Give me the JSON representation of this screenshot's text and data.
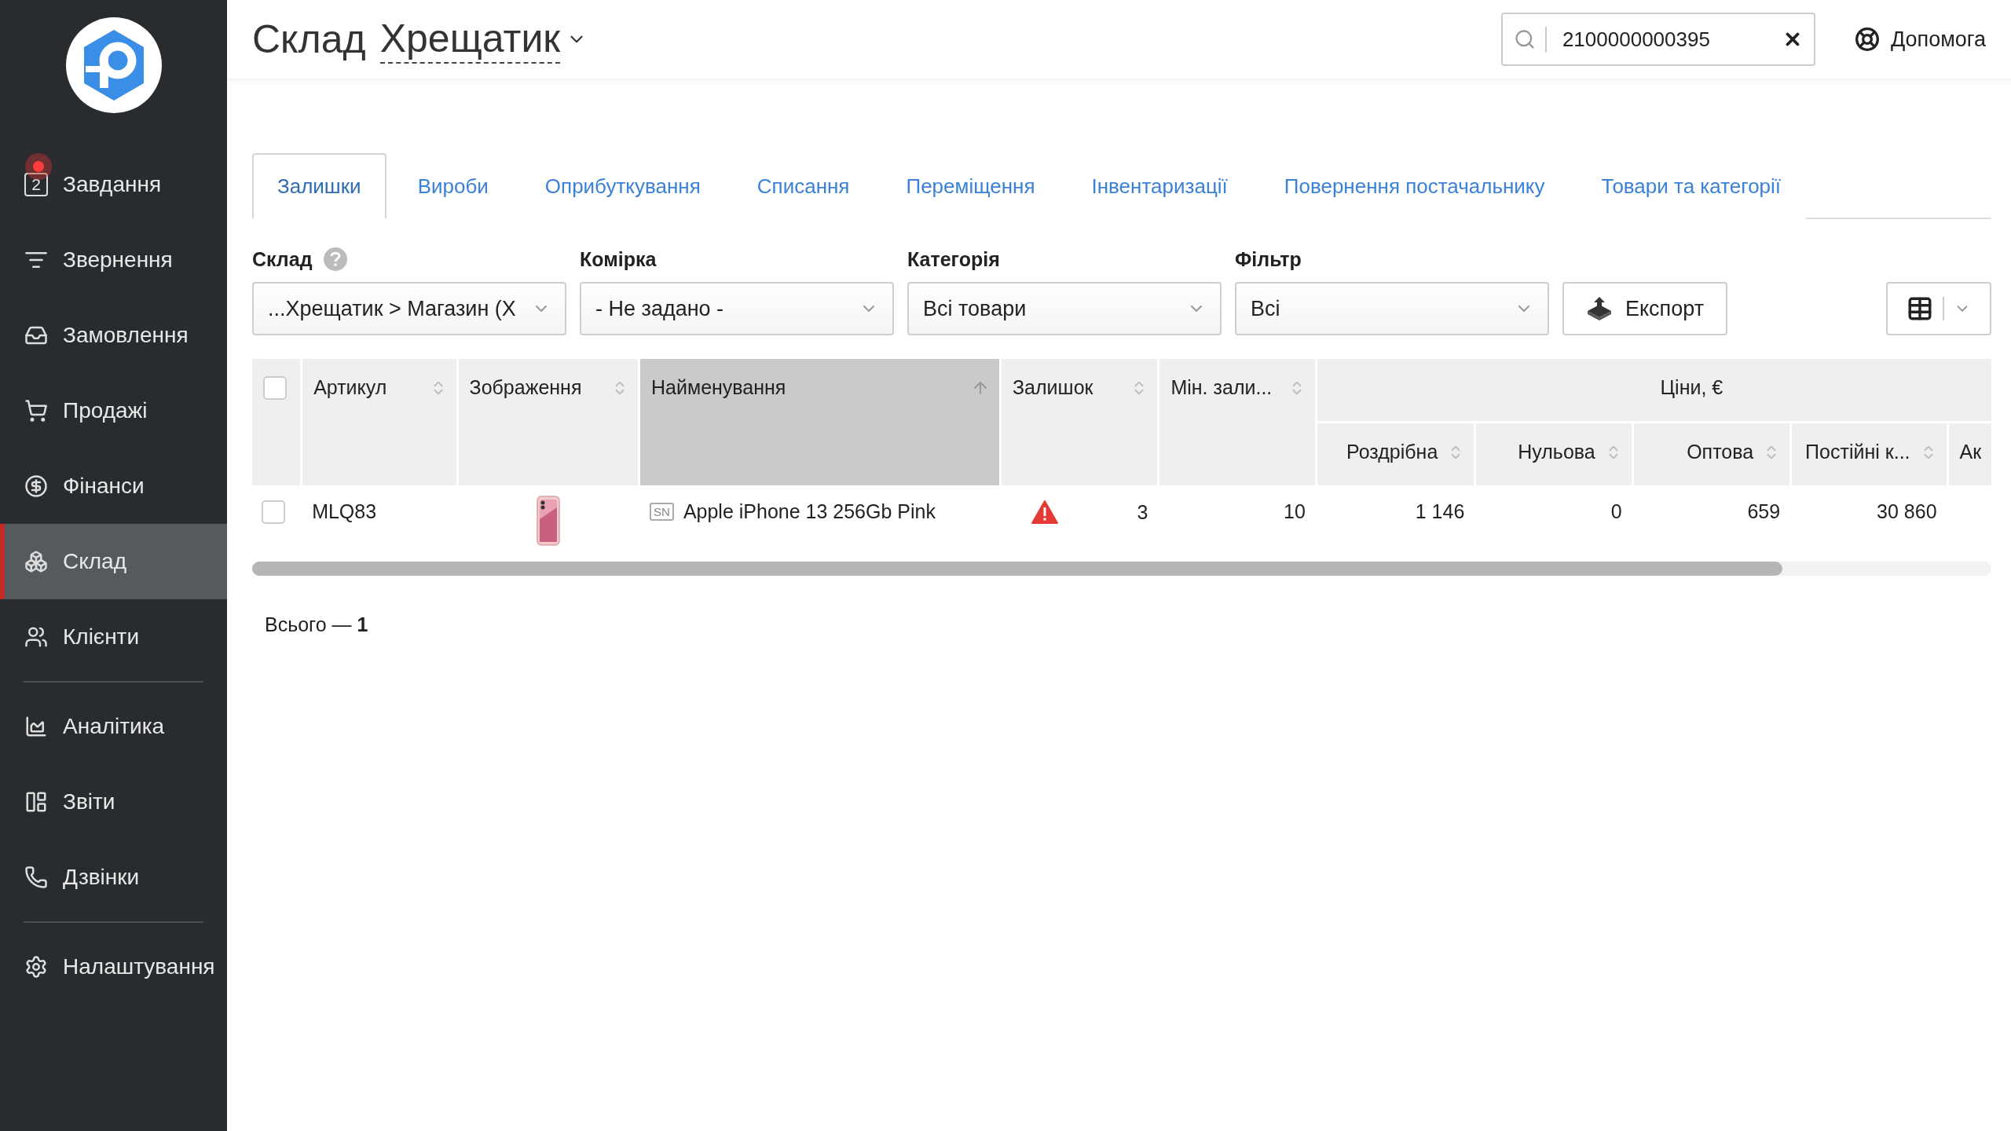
{
  "sidebar": {
    "groups": [
      {
        "items": [
          {
            "label": "Завдання",
            "badge": "2",
            "notification": true,
            "selected": false
          },
          {
            "label": "Звернення",
            "selected": false
          },
          {
            "label": "Замовлення",
            "selected": false
          },
          {
            "label": "Продажі",
            "selected": false
          },
          {
            "label": "Фінанси",
            "selected": false
          },
          {
            "label": "Склад",
            "selected": true
          },
          {
            "label": "Клієнти",
            "selected": false
          }
        ]
      },
      {
        "items": [
          {
            "label": "Аналітика",
            "selected": false
          },
          {
            "label": "Звіти",
            "selected": false
          },
          {
            "label": "Дзвінки",
            "selected": false
          }
        ]
      },
      {
        "items": [
          {
            "label": "Налаштування",
            "selected": false
          }
        ]
      }
    ]
  },
  "header": {
    "title": "Склад",
    "location": "Хрещатик",
    "search": {
      "value": "2100000000395"
    },
    "help": "Допомога"
  },
  "tabs": [
    {
      "label": "Залишки",
      "selected": true
    },
    {
      "label": "Вироби",
      "selected": false
    },
    {
      "label": "Оприбуткування",
      "selected": false
    },
    {
      "label": "Списання",
      "selected": false
    },
    {
      "label": "Переміщення",
      "selected": false
    },
    {
      "label": "Інвентаризації",
      "selected": false
    },
    {
      "label": "Повернення постачальнику",
      "selected": false
    },
    {
      "label": "Товари та категорії",
      "selected": false
    }
  ],
  "filters": [
    {
      "label": "Склад",
      "help": true,
      "value": "...Хрещатик > Магазин (Х"
    },
    {
      "label": "Комірка",
      "help": false,
      "value": "- Не задано -"
    },
    {
      "label": "Категорія",
      "help": false,
      "value": "Всі товари"
    },
    {
      "label": "Фільтр",
      "help": false,
      "value": "Всі"
    }
  ],
  "export_button": "Експорт",
  "table": {
    "select_all": false,
    "columns": [
      {
        "label": "Артикул",
        "sorted": false
      },
      {
        "label": "Зображення",
        "sorted": false
      },
      {
        "label": "Найменування",
        "sorted": true
      },
      {
        "label": "Залишок",
        "sorted": false
      },
      {
        "label": "Мін. зали...",
        "sorted": false
      },
      {
        "label": "Ціни, €",
        "children": [
          {
            "label": "Роздрібна",
            "sorted": false
          },
          {
            "label": "Нульова",
            "sorted": false
          },
          {
            "label": "Оптова",
            "sorted": false
          },
          {
            "label": "Постійні к...",
            "sorted": false
          },
          {
            "label": "Ак"
          }
        ]
      }
    ],
    "rows": [
      {
        "selected": false,
        "article": "MLQ83",
        "image": {
          "kind": "picture"
        },
        "tag": "SN",
        "name": "Apple iPhone 13 256Gb Pink",
        "warning": true,
        "stock": "3",
        "min_stock": "10",
        "prices": [
          "1 146",
          "0",
          "659",
          "30 860"
        ]
      }
    ]
  },
  "footer": {
    "total": "Всього — **1**"
  }
}
